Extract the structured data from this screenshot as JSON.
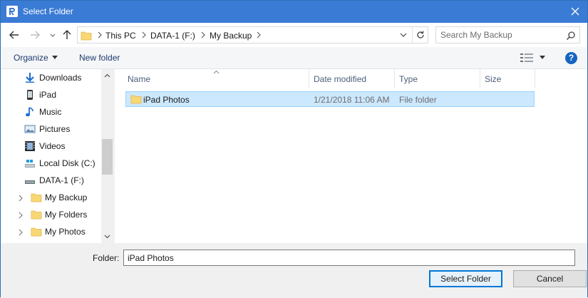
{
  "window": {
    "title": "Select Folder",
    "close_icon": "close-icon",
    "app_icon": "app-r-icon"
  },
  "nav": {
    "back_icon": "back-arrow-icon",
    "forward_icon": "forward-arrow-icon",
    "recent_icon": "chevron-down-icon",
    "up_icon": "up-arrow-icon",
    "breadcrumbs": [
      "This PC",
      "DATA-1 (F:)",
      "My Backup"
    ],
    "search_placeholder": "Search My Backup"
  },
  "toolbar": {
    "organize_label": "Organize",
    "new_folder_label": "New folder",
    "help_label": "?"
  },
  "sidebar": {
    "items": [
      {
        "label": "Downloads",
        "icon": "download-icon"
      },
      {
        "label": "iPad",
        "icon": "ipad-icon"
      },
      {
        "label": "Music",
        "icon": "music-icon"
      },
      {
        "label": "Pictures",
        "icon": "pictures-icon"
      },
      {
        "label": "Videos",
        "icon": "videos-icon"
      },
      {
        "label": "Local Disk (C:)",
        "icon": "drive-icon"
      },
      {
        "label": "DATA-1 (F:)",
        "icon": "drive-icon"
      },
      {
        "label": "My Backup",
        "icon": "folder-icon"
      },
      {
        "label": "My Folders",
        "icon": "folder-icon"
      },
      {
        "label": "My Photos",
        "icon": "folder-icon"
      }
    ]
  },
  "files": {
    "columns": [
      "Name",
      "Date modified",
      "Type",
      "Size"
    ],
    "rows": [
      {
        "name": "iPad Photos",
        "date_modified": "1/21/2018 11:06 AM",
        "type": "File folder",
        "size": ""
      }
    ]
  },
  "footer": {
    "folder_label": "Folder:",
    "folder_value": "iPad Photos",
    "select_label": "Select Folder",
    "cancel_label": "Cancel"
  },
  "colors": {
    "title_bar": "#3a7bd5",
    "selection": "#cce8ff",
    "folder": "#f8d775"
  }
}
